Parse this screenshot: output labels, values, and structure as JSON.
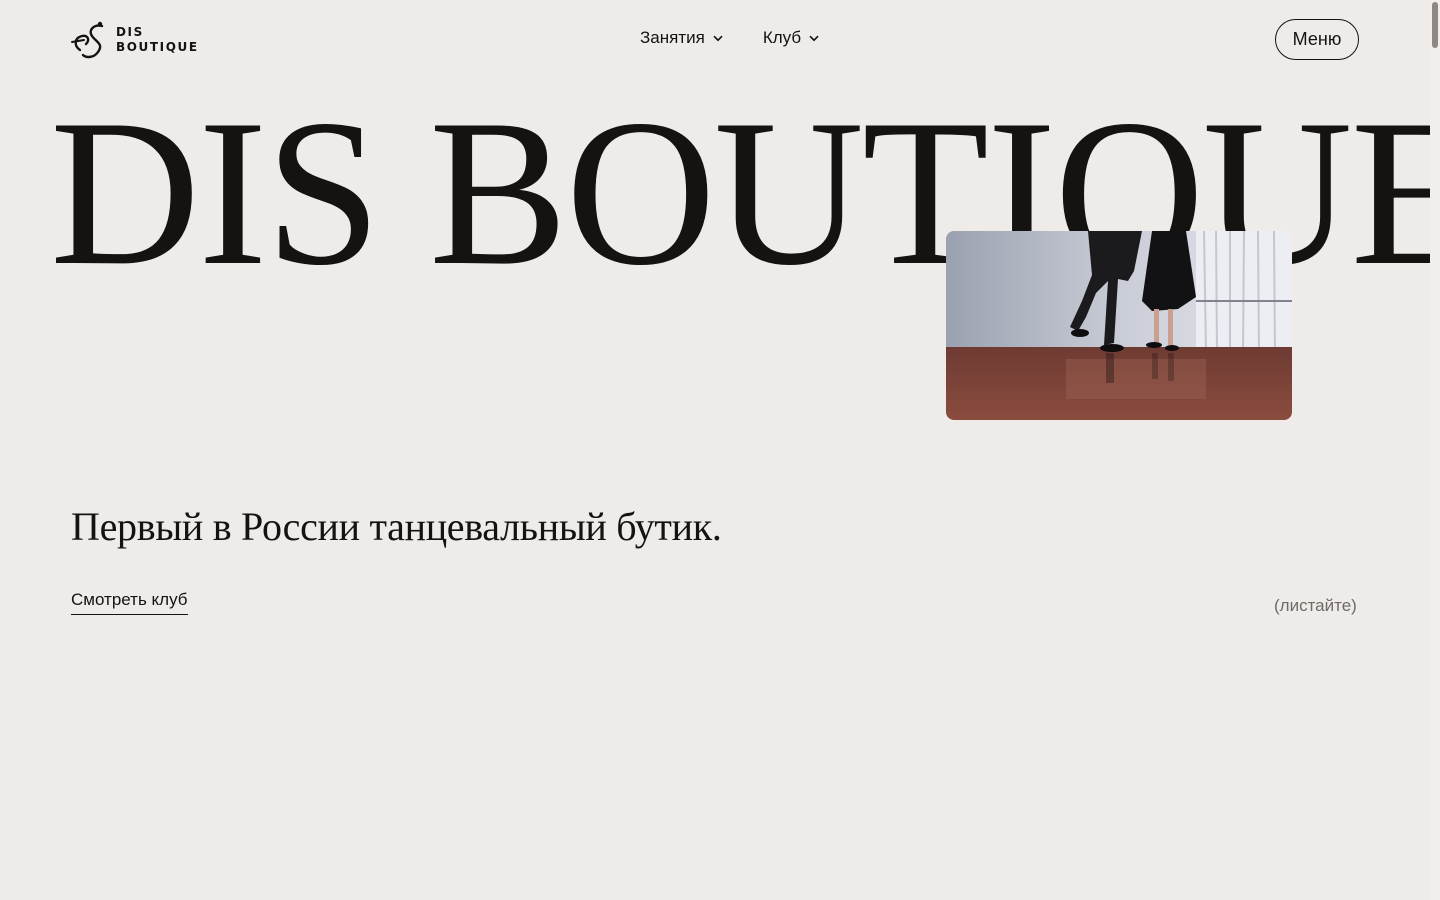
{
  "brand": {
    "line1": "DIS",
    "line2": "BOUTIQUE",
    "accent": "#141311",
    "background": "#efebe8"
  },
  "nav": {
    "items": [
      {
        "label": "Занятия",
        "icon": "chevron-down-icon"
      },
      {
        "label": "Клуб",
        "icon": "chevron-down-icon"
      }
    ],
    "menu_label": "Меню"
  },
  "hero": {
    "title": "DIS BOUTIQUE",
    "media_icon": "dancers-photo",
    "tagline": "Первый в России танцевальный бутик.",
    "cta_label": "Смотреть клуб",
    "scroll_hint": "(листайте)"
  }
}
